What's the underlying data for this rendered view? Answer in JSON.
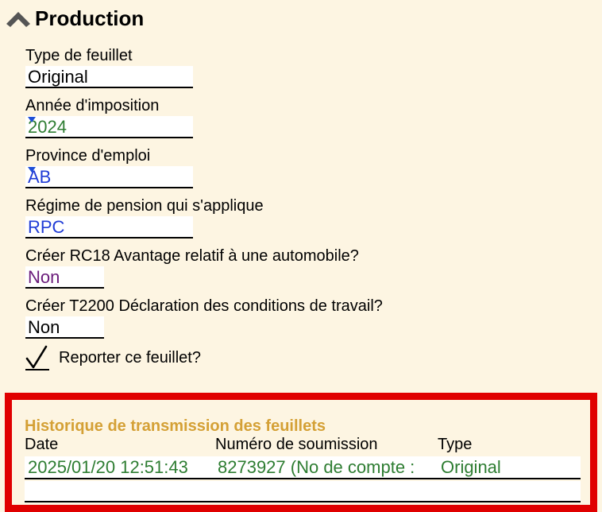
{
  "section": {
    "title": "Production",
    "collapse_icon": "chevron-up-icon"
  },
  "fields": {
    "type_feuillet": {
      "label": "Type de feuillet",
      "value": "Original",
      "color": "#000000"
    },
    "annee": {
      "label": "Année d'imposition",
      "value": "2024",
      "color": "#2e7d32"
    },
    "province": {
      "label": "Province d'emploi",
      "value": "AB",
      "color": "#1f3bd6"
    },
    "regime": {
      "label": "Régime de pension qui s'applique",
      "value": "RPC",
      "color": "#1f3bd6"
    },
    "rc18": {
      "label": "Créer RC18 Avantage relatif à une automobile?",
      "value": "Non",
      "color": "#6a1b7a"
    },
    "t2200": {
      "label": "Créer T2200 Déclaration des conditions de travail?",
      "value": "Non",
      "color": "#000000"
    }
  },
  "report": {
    "label": "Reporter ce feuillet?",
    "checked": true,
    "icon": "checkmark-icon"
  },
  "history": {
    "title": "Historique de transmission des feuillets",
    "headers": {
      "date": "Date",
      "numero": "Numéro de soumission",
      "type": "Type"
    },
    "rows": [
      {
        "date": "2025/01/20 12:51:43",
        "numero": "8273927 (No de compte :",
        "type": "Original"
      }
    ],
    "border_color": "#e00000",
    "title_color": "#d4a035",
    "row_color": "#2e7d32"
  }
}
